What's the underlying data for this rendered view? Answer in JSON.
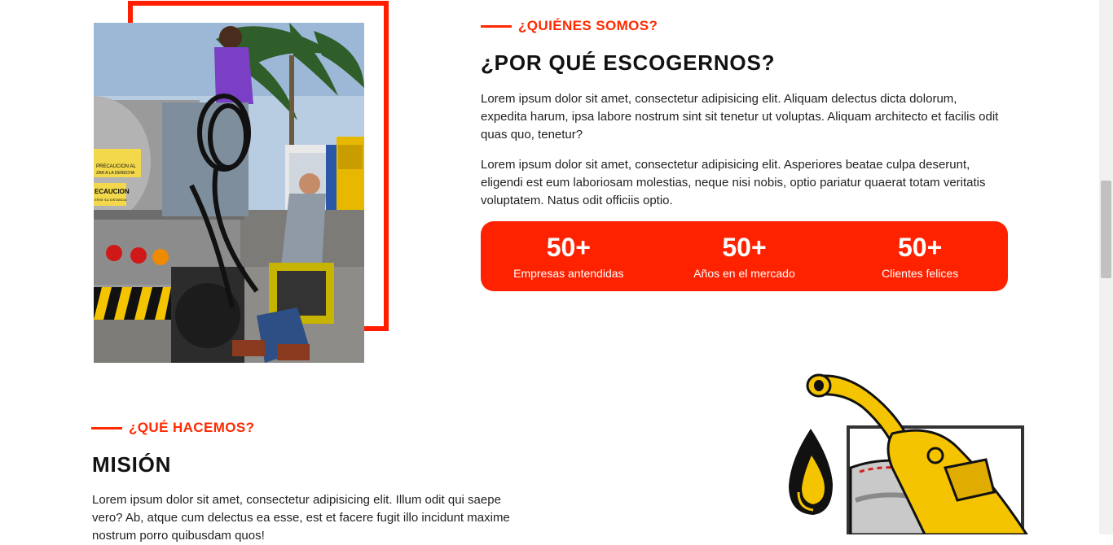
{
  "about": {
    "eyebrow": "¿QUIÉNES SOMOS?",
    "heading": "¿POR QUÉ ESCOGERNOS?",
    "paragraph1": "Lorem ipsum dolor sit amet, consectetur adipisicing elit. Aliquam delectus dicta dolorum, expedita harum, ipsa labore nostrum sint sit tenetur ut voluptas. Aliquam architecto et facilis odit quas quo, tenetur?",
    "paragraph2": "Lorem ipsum dolor sit amet, consectetur adipisicing elit. Asperiores beatae culpa deserunt, eligendi est eum laboriosam molestias, neque nisi nobis, optio pariatur quaerat totam veritatis voluptatem. Natus odit officiis optio.",
    "photo_signs": {
      "sign1_line1": "PRECAUCION AL",
      "sign1_line2": "ZAR A LA DERECHA",
      "sign2_line1": "ECAUCION",
      "sign2_line2": "ERVE SU DISTANCIA"
    },
    "stats": [
      {
        "number": "50+",
        "label": "Empresas antendidas"
      },
      {
        "number": "50+",
        "label": "Años en el mercado"
      },
      {
        "number": "50+",
        "label": "Clientes felices"
      }
    ]
  },
  "mission": {
    "eyebrow": "¿QUÉ HACEMOS?",
    "heading": "MISIÓN",
    "paragraph": "Lorem ipsum dolor sit amet, consectetur adipisicing elit. Illum odit qui saepe vero? Ab, atque cum delectus ea esse, est et facere fugit illo incidunt maxime nostrum porro quibusdam quos!"
  },
  "colors": {
    "accent": "#ff2200",
    "text": "#111111",
    "fuel_yellow": "#f5c400"
  }
}
